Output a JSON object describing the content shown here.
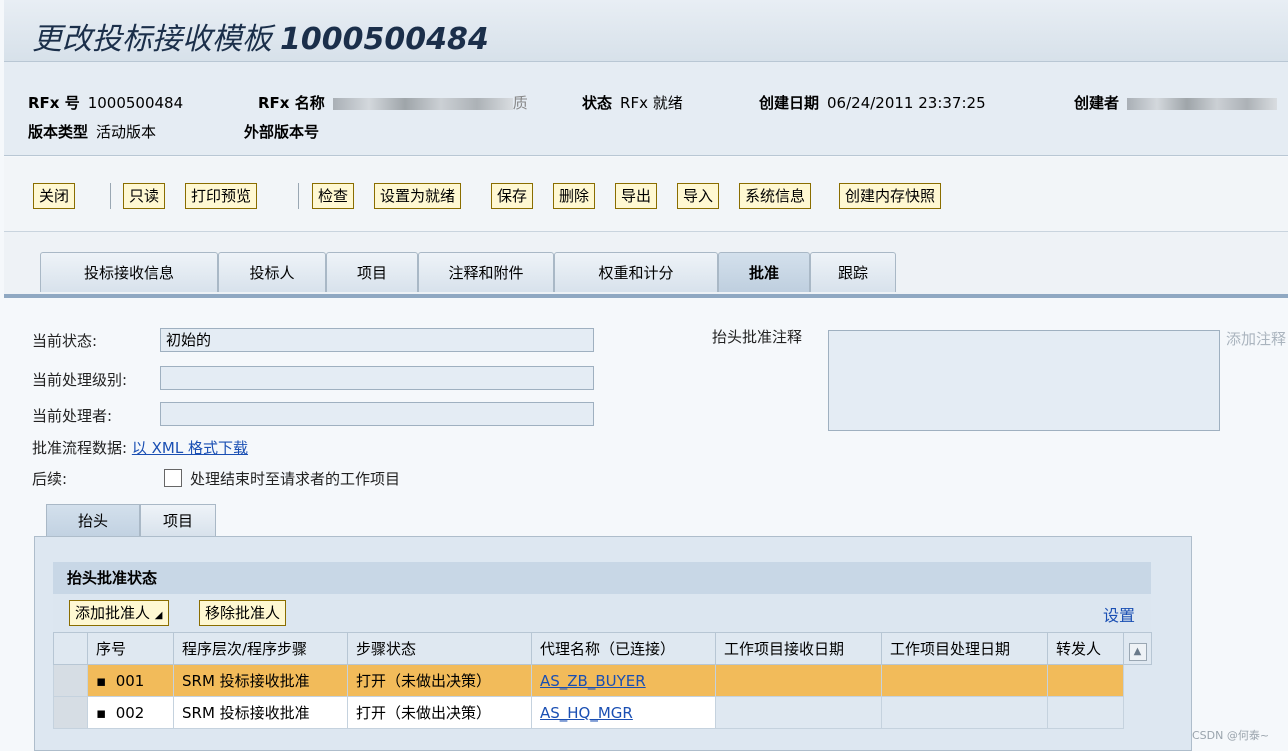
{
  "title": {
    "text": "更改投标接收模板",
    "number": "1000500484"
  },
  "header": {
    "rfx_no_label": "RFx 号",
    "rfx_no": "1000500484",
    "rfx_name_label": "RFx 名称",
    "rfx_name_tail": "质",
    "status_label": "状态",
    "status": "RFx 就绪",
    "created_label": "创建日期",
    "created": "06/24/2011 23:37:25",
    "creator_label": "创建者",
    "version_type_label": "版本类型",
    "version_type": "活动版本",
    "ext_version_label": "外部版本号"
  },
  "toolbar": [
    "关闭",
    "只读",
    "打印预览",
    "检查",
    "设置为就绪",
    "保存",
    "删除",
    "导出",
    "导入",
    "系统信息",
    "创建内存快照"
  ],
  "tabs": [
    "投标接收信息",
    "投标人",
    "项目",
    "注释和附件",
    "权重和计分",
    "批准",
    "跟踪"
  ],
  "approval": {
    "cur_status_label": "当前状态:",
    "cur_status": "初始的",
    "cur_level_label": "当前处理级别:",
    "cur_level": "",
    "cur_processor_label": "当前处理者:",
    "cur_processor": "",
    "flow_data_label": "批准流程数据:",
    "flow_data_link": "以 XML 格式下载",
    "followup_label": "后续:",
    "followup_checkbox": "处理结束时至请求者的工作项目",
    "header_note_label": "抬头批准注释",
    "add_note": "添加注释"
  },
  "subtabs": [
    "抬头",
    "项目"
  ],
  "panel": {
    "title": "抬头批准状态",
    "add_approver": "添加批准人",
    "remove_approver": "移除批准人",
    "settings": "设置",
    "columns": [
      "序号",
      "程序层次/程序步骤",
      "步骤状态",
      "代理名称（已连接）",
      "工作项目接收日期",
      "工作项目处理日期",
      "转发人"
    ],
    "rows": [
      {
        "seq": "001",
        "step": "SRM 投标接收批准",
        "status": "打开（未做出决策）",
        "agent": "AS_ZB_BUYER",
        "recv": "",
        "proc": "",
        "fwd": ""
      },
      {
        "seq": "002",
        "step": "SRM 投标接收批准",
        "status": "打开（未做出决策）",
        "agent": "AS_HQ_MGR",
        "recv": "",
        "proc": "",
        "fwd": ""
      }
    ]
  },
  "watermark": "CSDN @何泰~"
}
